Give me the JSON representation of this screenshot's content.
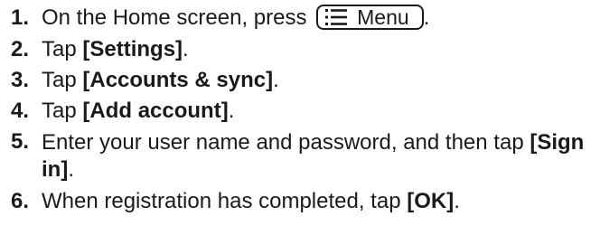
{
  "steps": [
    {
      "number": "1.",
      "text_before": "On the Home screen, press",
      "key_label": "Menu",
      "key_icon": "menu-list-icon",
      "text_after": "."
    },
    {
      "number": "2.",
      "text_before": "Tap ",
      "bold": "[Settings]",
      "text_after": "."
    },
    {
      "number": "3.",
      "text_before": "Tap ",
      "bold": "[Accounts & sync]",
      "text_after": "."
    },
    {
      "number": "4.",
      "text_before": "Tap ",
      "bold": "[Add account]",
      "text_after": "."
    },
    {
      "number": "5.",
      "text_before": "Enter your user name and password, and then tap ",
      "bold": "[Sign in]",
      "text_after": "."
    },
    {
      "number": "6.",
      "text_before": "When registration has completed, tap ",
      "bold": "[OK]",
      "text_after": "."
    }
  ]
}
